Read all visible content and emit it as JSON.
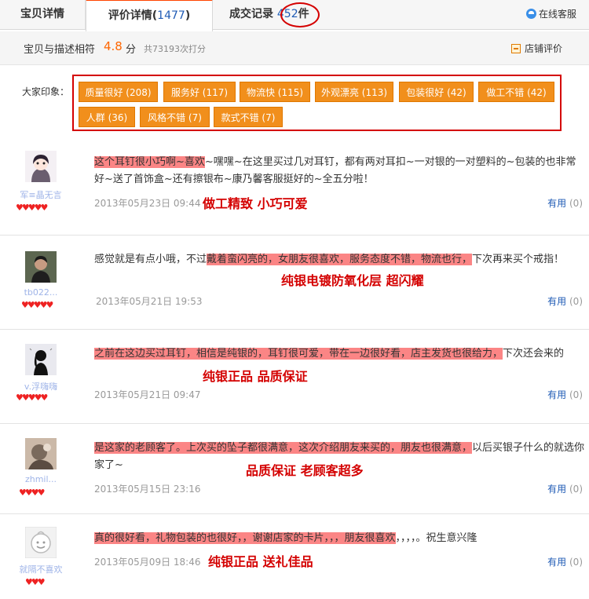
{
  "tabs": {
    "item_details": "宝贝详情",
    "reviews_label": "评价详情",
    "reviews_count": "1477",
    "records_label": "成交记录",
    "records_count": "452",
    "records_unit": "件"
  },
  "service": {
    "label": "在线客服",
    "icon": "customer-service-icon"
  },
  "score": {
    "label": "宝贝与描述相符",
    "value": "4.8",
    "unit": "分",
    "count_text": "共73193次打分",
    "shop_rating": "店铺评价"
  },
  "impressions": {
    "label": "大家印象：",
    "tags": [
      "质量很好 (208)",
      "服务好 (117)",
      "物流快 (115)",
      "外观漂亮 (113)",
      "包装很好 (42)",
      "做工不错 (42)",
      "人群 (36)",
      "风格不错 (7)",
      "款式不错 (7)"
    ]
  },
  "reviews": [
    {
      "nick": "军≡晶无言",
      "hearts": "♥♥♥♥♥",
      "highlight": "这个耳钉很小巧啊~喜欢",
      "text_after": "~嘿嘿~在这里买过几对耳钉，都有两对耳扣~一对银的一对塑料的~包装的也非常好~送了首饰盒~还有擦银布~康乃馨客服挺好的~全五分啦！",
      "date": "2013年05月23日 09:44",
      "tag": "做工精致  小巧可爱",
      "useful_label": "有用",
      "useful_count": "(0)"
    },
    {
      "nick": "tb022...",
      "hearts": "♥♥♥♥♥",
      "text_before": "感觉就是有点小哦，不过",
      "highlight": "戴着蛮闪亮的，女朋友很喜欢，服务态度不错，物流也行，",
      "text_after": "下次再来买个戒指！",
      "date": "2013年05月21日 19:53",
      "tag": "纯银电镀防氧化层  超闪耀",
      "useful_label": "有用",
      "useful_count": "(0)"
    },
    {
      "nick": "v.浮嗨嗨",
      "hearts": "♥♥♥♥♥",
      "highlight": "之前在这边买过耳钉，相信是纯银的，耳钉很可爱，带在一边很好看，店主发货也很给力，",
      "text_after": "下次还会来的",
      "date": "2013年05月21日 09:47",
      "tag": "纯银正品  品质保证",
      "useful_label": "有用",
      "useful_count": "(0)"
    },
    {
      "nick": "zhmil...",
      "hearts": "♥♥♥♥",
      "highlight": "是这家的老顾客了。上次买的坠子都很满意，这次介绍朋友来买的，朋友也很满意，",
      "text_after": "以后买银子什么的就选你家了~",
      "date": "2013年05月15日 23:16",
      "tag": "品质保证  老顾客超多",
      "useful_label": "有用",
      "useful_count": "(0)"
    },
    {
      "nick": "就隔不喜欢",
      "hearts": "♥♥♥",
      "highlight": "真的很好看，礼物包装的也很好，，谢谢店家的卡片，，，朋友很喜欢",
      "text_after": "，，，，。祝生意兴隆",
      "date": "2013年05月09日 18:46",
      "tag": "纯银正品  送礼佳品",
      "useful_label": "有用",
      "useful_count": "(0)"
    }
  ],
  "colors": {
    "accent": "#ff6600",
    "tag_bg": "#f18f1c",
    "highlight": "#fb8585",
    "mark_red": "#d40000",
    "link_blue": "#1f5bb5"
  }
}
